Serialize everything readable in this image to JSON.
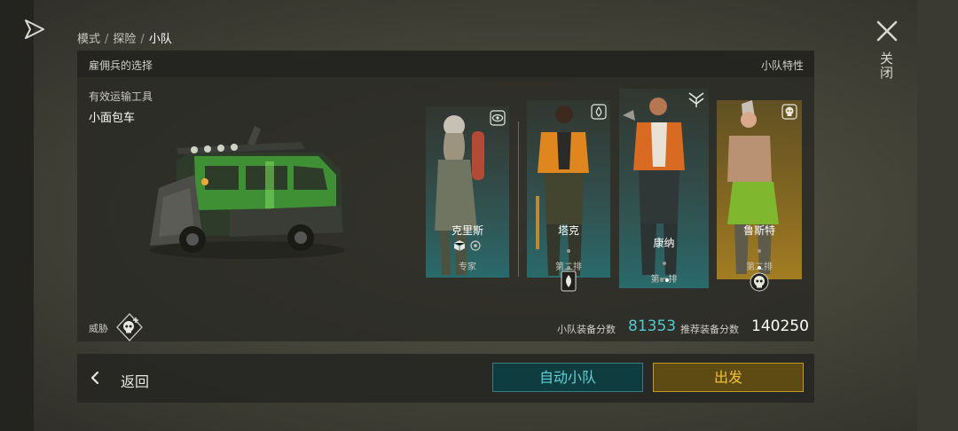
{
  "breadcrumb": {
    "mode": "模式",
    "explore": "探险",
    "current": "小队",
    "separator": "/"
  },
  "close": {
    "label": "关闭"
  },
  "panel": {
    "title": "雇佣兵的选择",
    "traits_label": "小队特性",
    "vehicle_label": "有效运输工具",
    "vehicle_name": "小面包车"
  },
  "mercenaries": [
    {
      "name": "克里斯",
      "role": "专家",
      "theme": "teal",
      "badge": "eye-icon"
    },
    {
      "name": "塔克",
      "role": "第二排",
      "theme": "teal",
      "badge": "fire-icon",
      "rank_dots_lit": 0,
      "rank_dots_total": 2
    },
    {
      "name": "康纳",
      "role": "第一排",
      "theme": "teal",
      "badge": "chevron-rank-icon",
      "rank_dots_lit": 1,
      "rank_dots_total": 2
    },
    {
      "name": "鲁斯特",
      "role": "第二排",
      "theme": "gold",
      "badge": "skull-icon",
      "rank_dots_lit": 1,
      "rank_dots_total": 2
    }
  ],
  "threat": {
    "label": "威胁"
  },
  "scores": {
    "squad_label": "小队装备分数",
    "squad_value": "81353",
    "recommended_label": "推荐装备分数",
    "recommended_value": "140250",
    "squad_color": "#4fc8d0",
    "recommended_color": "#ffffff"
  },
  "buttons": {
    "back": "返回",
    "auto_squad": "自动小队",
    "go": "出发"
  },
  "colors": {
    "teal": "#2a6a6c",
    "gold": "#a37d22",
    "accent_teal": "#5fd3d9",
    "accent_gold": "#f3c035"
  }
}
